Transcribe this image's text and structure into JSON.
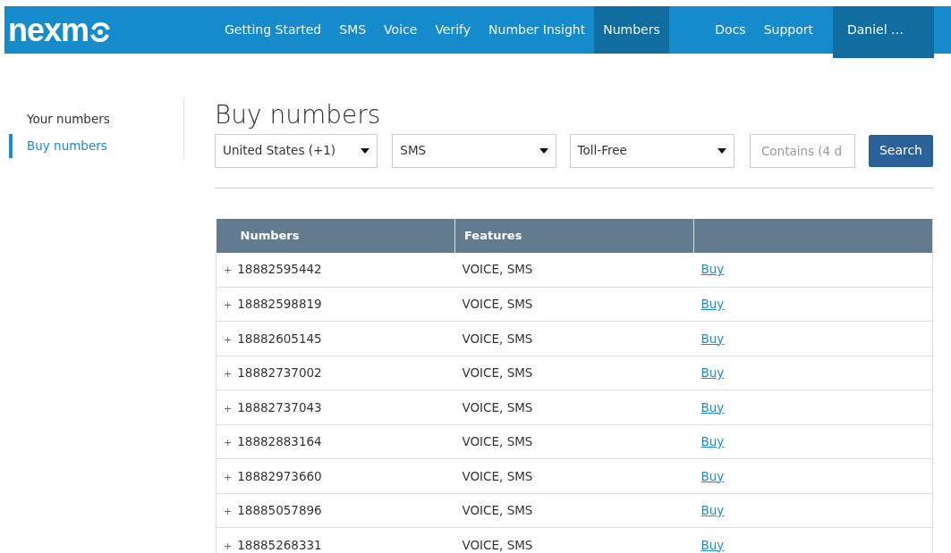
{
  "brand": {
    "text": "nexm"
  },
  "nav": [
    {
      "label": "Getting Started",
      "selected": false
    },
    {
      "label": "SMS",
      "selected": false
    },
    {
      "label": "Voice",
      "selected": false
    },
    {
      "label": "Verify",
      "selected": false
    },
    {
      "label": "Number Insight",
      "selected": false
    },
    {
      "label": "Numbers",
      "selected": true
    }
  ],
  "nav_right": [
    {
      "label": "Docs"
    },
    {
      "label": "Support"
    }
  ],
  "user": {
    "label": "Daniel …"
  },
  "sidebar": {
    "items": [
      {
        "label": "Your numbers",
        "selected": false
      },
      {
        "label": "Buy numbers",
        "selected": true
      }
    ]
  },
  "page_title": "Buy numbers",
  "filters": {
    "country": "United States (+1)",
    "feature": "SMS",
    "type": "Toll-Free",
    "contains_placeholder": "Contains (4 d",
    "button": "Search"
  },
  "table": {
    "columns": [
      "Numbers",
      "Features"
    ],
    "rows": [
      {
        "toggle": "+",
        "number": "18882595442",
        "features": "VOICE, SMS",
        "action": "Buy"
      },
      {
        "toggle": "+",
        "number": "18882598819",
        "features": "VOICE, SMS",
        "action": "Buy"
      },
      {
        "toggle": "+",
        "number": "18882605145",
        "features": "VOICE, SMS",
        "action": "Buy"
      },
      {
        "toggle": "+",
        "number": "18882737002",
        "features": "VOICE, SMS",
        "action": "Buy"
      },
      {
        "toggle": "+",
        "number": "18882737043",
        "features": "VOICE, SMS",
        "action": "Buy"
      },
      {
        "toggle": "+",
        "number": "18882883164",
        "features": "VOICE, SMS",
        "action": "Buy"
      },
      {
        "toggle": "+",
        "number": "18882973660",
        "features": "VOICE, SMS",
        "action": "Buy"
      },
      {
        "toggle": "+",
        "number": "18885057896",
        "features": "VOICE, SMS",
        "action": "Buy"
      },
      {
        "toggle": "+",
        "number": "18885268331",
        "features": "VOICE, SMS",
        "action": "Buy"
      }
    ]
  }
}
